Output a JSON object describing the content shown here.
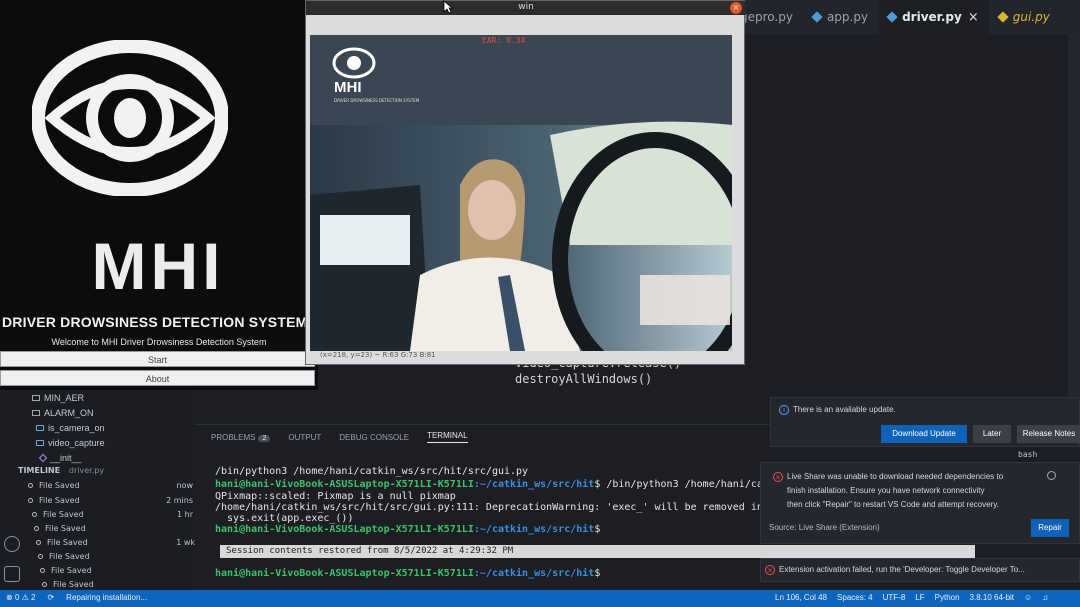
{
  "cam_window": {
    "title": "win",
    "close": "×",
    "ear_text": "EAR: 0.34",
    "logo_text": "MHI",
    "logo_sub": "DRIVER DROWSINESS DETECTION SYSTEM",
    "status_text": "(x=218, y=23) ~ R:63 G:73 B:81"
  },
  "gui_window": {
    "logo_text": "MHI",
    "system_title": "DRIVER DROWSINESS DETECTION SYSTEM",
    "welcome": "Welcome to MHI Driver Drowsiness Detection System",
    "start_label": "Start",
    "about_label": "About"
  },
  "tabs": [
    {
      "label": "gepro.py"
    },
    {
      "label": "app.py"
    },
    {
      "label": "driver.py"
    },
    {
      "label": "gui.py"
    }
  ],
  "tab_close": "×",
  "editor": {
    "lines": [
      "video_capture.release()",
      "destroyAllWindows()"
    ]
  },
  "outline": {
    "items": [
      "MIN_AER",
      "ALARM_ON",
      "is_camera_on",
      "video_capture",
      "__init__"
    ]
  },
  "timeline": {
    "header": "TIMELINE",
    "file": "driver.py",
    "rows": [
      {
        "label": "File Saved",
        "time": "now"
      },
      {
        "label": "File Saved",
        "time": "2 mins"
      },
      {
        "label": "File Saved",
        "time": "1 hr"
      },
      {
        "label": "File Saved",
        "time": ""
      },
      {
        "label": "File Saved",
        "time": "1 wk"
      },
      {
        "label": "File Saved",
        "time": ""
      },
      {
        "label": "File Saved",
        "time": ""
      },
      {
        "label": "File Saved",
        "time": ""
      }
    ]
  },
  "panel": {
    "tabs": [
      "PROBLEMS",
      "OUTPUT",
      "DEBUG CONSOLE",
      "TERMINAL"
    ],
    "problems_count": "2"
  },
  "terminal": {
    "line1": "/bin/python3 /home/hani/catkin_ws/src/hit/src/gui.py",
    "prompt_user": "hani@hani-VivoBook-ASUSLaptop-X571LI-K571LI",
    "prompt_path": ":~/catkin_ws/src/hit",
    "cmd2": "$ /bin/python3 /home/hani/ca",
    "line3": "QPixmap::scaled: Pixmap is a null pixmap",
    "line4": "/home/hani/catkin_ws/src/hit/src/gui.py:111: DeprecationWarning: 'exec_' will be removed in",
    "line5": "  sys.exit(app.exec_())",
    "dollar": "$",
    "restored": "Session contents restored from 8/5/2022 at 4:29:32 PM",
    "bash": "bash"
  },
  "notifications": {
    "update": {
      "text": "There is an available update.",
      "btn_download": "Download Update",
      "btn_later": "Later",
      "btn_release": "Release Notes"
    },
    "liveshare": {
      "text1": "Live Share was unable to download needed dependencies to",
      "text2": "finish installation. Ensure you have network connectivity",
      "text3": "then click \"Repair\" to restart VS Code and attempt recovery.",
      "source": "Source: Live Share (Extension)",
      "btn_repair": "Repair"
    },
    "extension": {
      "text": "Extension activation failed, run the 'Developer: Toggle Developer To..."
    }
  },
  "statusbar": {
    "errors": "0",
    "warnings": "2",
    "repairing": "Repairing installation...",
    "position": "Ln 106, Col 48",
    "spaces": "Spaces: 4",
    "encoding": "UTF-8",
    "eol": "LF",
    "language": "Python",
    "interpreter": "3.8.10 64-bit"
  },
  "colors": {
    "accent": "#0b65bf",
    "terminal_prompt": "#3ec16b",
    "terminal_path": "#3b8fde",
    "error": "#f14c4c",
    "info": "#4ea1f0"
  }
}
